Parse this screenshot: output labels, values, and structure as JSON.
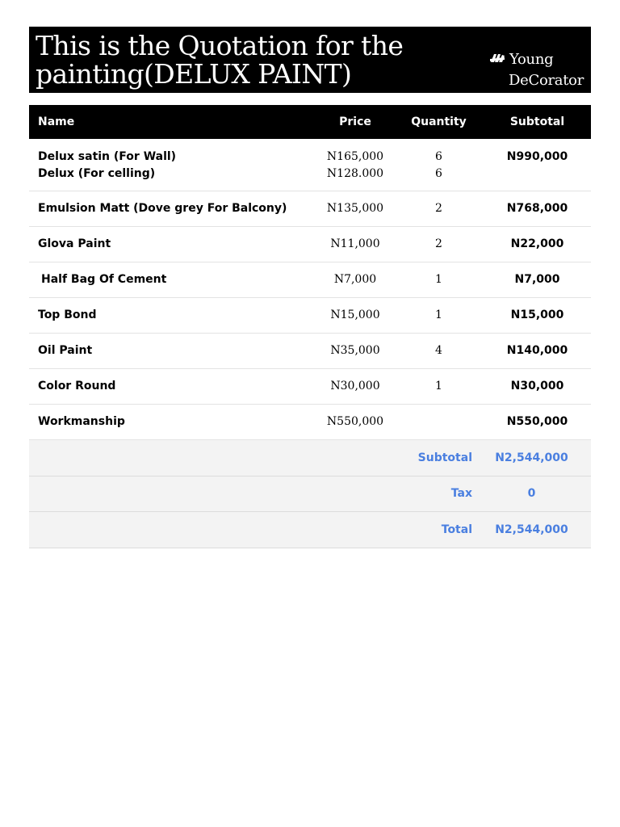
{
  "header": {
    "title_line1": "This is the Quotation for the",
    "title_line2": "painting(DELUX PAINT)",
    "brand_line1": "Young",
    "brand_line2": "DeCorator"
  },
  "table": {
    "columns": {
      "name": "Name",
      "price": "Price",
      "quantity": "Quantity",
      "subtotal": "Subtotal"
    },
    "rows": [
      {
        "name": "Delux satin (For Wall)",
        "price": "N165,000",
        "quantity": "6",
        "subtotal": "N990,000",
        "name2": "Delux (For celling)",
        "price2": "N128.000",
        "quantity2": "6"
      },
      {
        "name": "Emulsion Matt (Dove grey For Balcony)",
        "price": "N135,000",
        "quantity": "2",
        "subtotal": "N768,000"
      },
      {
        "name": " Glova Paint",
        "price": "N11,000",
        "quantity": "2",
        "subtotal": "N22,000"
      },
      {
        "name": " Half Bag Of Cement",
        "price": "N7,000",
        "quantity": "1",
        "subtotal": "N7,000"
      },
      {
        "name": "Top Bond",
        "price": "N15,000",
        "quantity": "1",
        "subtotal": "N15,000"
      },
      {
        "name": "Oil Paint",
        "price": "N35,000",
        "quantity": "4",
        "subtotal": "N140,000"
      },
      {
        "name": "Color Round",
        "price": "N30,000",
        "quantity": "1",
        "subtotal": "N30,000"
      },
      {
        "name": "Workmanship",
        "price": "N550,000",
        "quantity": "",
        "subtotal": "N550,000"
      }
    ]
  },
  "summary": {
    "subtotal_label": "Subtotal",
    "subtotal_value": "N2,544,000",
    "tax_label": "Tax",
    "tax_value": "0",
    "total_label": "Total",
    "total_value": "N2,544,000"
  },
  "colors": {
    "accent": "#4a7fe0",
    "banner": "#000000"
  }
}
